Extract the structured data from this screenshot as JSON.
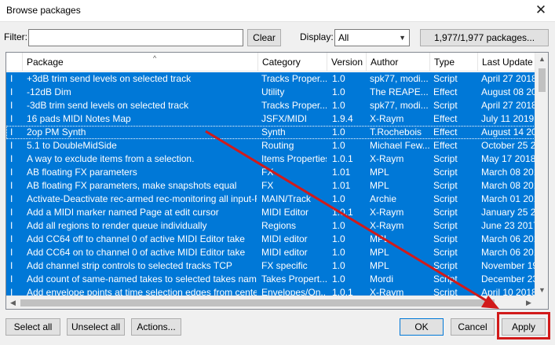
{
  "window": {
    "title": "Browse packages",
    "close_glyph": "✕"
  },
  "toolbar": {
    "filter_label": "Filter:",
    "filter_value": "",
    "clear_label": "Clear",
    "display_label": "Display:",
    "display_value": "All",
    "package_count_label": "1,977/1,977 packages..."
  },
  "columns": [
    "Package",
    "Category",
    "Version",
    "Author",
    "Type",
    "Last Update"
  ],
  "rows": [
    {
      "status": "I",
      "package": "+3dB trim send levels on selected track",
      "category": "Tracks Proper...",
      "version": "1.0",
      "author": "spk77, modi...",
      "type": "Script",
      "last_update": "April 27 2018"
    },
    {
      "status": "I",
      "package": "-12dB Dim",
      "category": "Utility",
      "version": "1.0",
      "author": "The REAPE...",
      "type": "Effect",
      "last_update": "August 08 20"
    },
    {
      "status": "I",
      "package": "-3dB trim send levels on selected track",
      "category": "Tracks Proper...",
      "version": "1.0",
      "author": "spk77, modi...",
      "type": "Script",
      "last_update": "April 27 2018"
    },
    {
      "status": "I",
      "package": "16 pads MIDI Notes Map",
      "category": "JSFX/MIDI",
      "version": "1.9.4",
      "author": "X-Raym",
      "type": "Effect",
      "last_update": "July 11 2019"
    },
    {
      "status": "I",
      "package": "2op PM Synth",
      "category": "Synth",
      "version": "1.0",
      "author": "T.Rochebois",
      "type": "Effect",
      "last_update": "August 14 20"
    },
    {
      "status": "I",
      "package": "5.1 to DoubleMidSide",
      "category": "Routing",
      "version": "1.0",
      "author": "Michael Few...",
      "type": "Effect",
      "last_update": "October 25 2"
    },
    {
      "status": "I",
      "package": "A way to exclude items from a selection.",
      "category": "Items Properties",
      "version": "1.0.1",
      "author": "X-Raym",
      "type": "Script",
      "last_update": "May 17 2018"
    },
    {
      "status": "I",
      "package": "AB floating FX parameters",
      "category": "FX",
      "version": "1.01",
      "author": "MPL",
      "type": "Script",
      "last_update": "March 08 201"
    },
    {
      "status": "I",
      "package": "AB floating FX parameters, make snapshots equal",
      "category": "FX",
      "version": "1.01",
      "author": "MPL",
      "type": "Script",
      "last_update": "March 08 201"
    },
    {
      "status": "I",
      "package": "Activate-Deactivate rec-armed rec-monitoring all input-F...",
      "category": "MAIN/Track",
      "version": "1.0",
      "author": "Archie",
      "type": "Script",
      "last_update": "March 01 201"
    },
    {
      "status": "I",
      "package": "Add a MIDI marker named Page at edit cursor",
      "category": "MIDI Editor",
      "version": "1.0.1",
      "author": "X-Raym",
      "type": "Script",
      "last_update": "January 25 2"
    },
    {
      "status": "I",
      "package": "Add all regions to render queue individually",
      "category": "Regions",
      "version": "1.0",
      "author": "X-Raym",
      "type": "Script",
      "last_update": "June 23 2017"
    },
    {
      "status": "I",
      "package": "Add CC64 off to channel 0 of active MIDI Editor take",
      "category": "MIDI editor",
      "version": "1.0",
      "author": "MPL",
      "type": "Script",
      "last_update": "March 06 201"
    },
    {
      "status": "I",
      "package": "Add CC64 on to channel 0 of active MIDI Editor take",
      "category": "MIDI editor",
      "version": "1.0",
      "author": "MPL",
      "type": "Script",
      "last_update": "March 06 201"
    },
    {
      "status": "I",
      "package": "Add channel strip controls to selected tracks TCP",
      "category": "FX specific",
      "version": "1.0",
      "author": "MPL",
      "type": "Script",
      "last_update": "November 19"
    },
    {
      "status": "I",
      "package": "Add count of same-named takes to selected takes names...",
      "category": "Takes Propert...",
      "version": "1.0",
      "author": "Mordi",
      "type": "Script",
      "last_update": "December 23"
    },
    {
      "status": "I",
      "package": "Add envelope points at time selection edges from center ...",
      "category": "Envelopes/On...",
      "version": "1.0.1",
      "author": "X-Raym",
      "type": "Script",
      "last_update": "April 10 2018"
    }
  ],
  "buttons": {
    "select_all": "Select all",
    "unselect_all": "Unselect all",
    "actions": "Actions...",
    "ok": "OK",
    "cancel": "Cancel",
    "apply": "Apply"
  },
  "colors": {
    "selection": "#0078d7",
    "annotation": "#d11a1a"
  },
  "icons": {
    "close": "close-icon",
    "sort": "sort-ascending-icon",
    "scroll_up": "scroll-up-icon",
    "scroll_down": "scroll-down-icon",
    "scroll_left": "scroll-left-icon",
    "scroll_right": "scroll-right-icon"
  }
}
